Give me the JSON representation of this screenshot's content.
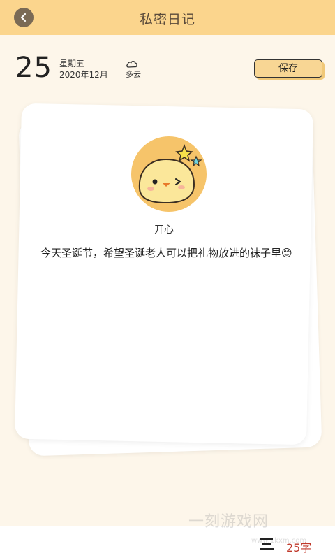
{
  "header": {
    "title": "私密日记"
  },
  "date": {
    "day": "25",
    "weekday": "星期五",
    "month": "2020年12月"
  },
  "weather": {
    "label": "多云",
    "icon": "cloud-icon"
  },
  "toolbar": {
    "save_label": "保存"
  },
  "card": {
    "mood_label": "开心",
    "entry_text": "今天圣诞节，希望圣诞老人可以把礼物放进的袜子里😊"
  },
  "footer": {
    "word_count": "25字",
    "menu_icon": "menu-icon"
  },
  "watermark": {
    "text": "一刻游戏网",
    "url": "www.1kxm.com"
  },
  "colors": {
    "topbar": "#fbd58d",
    "background": "#fdf6ea",
    "accent": "#c0392b",
    "save_button": "#f8d694"
  }
}
